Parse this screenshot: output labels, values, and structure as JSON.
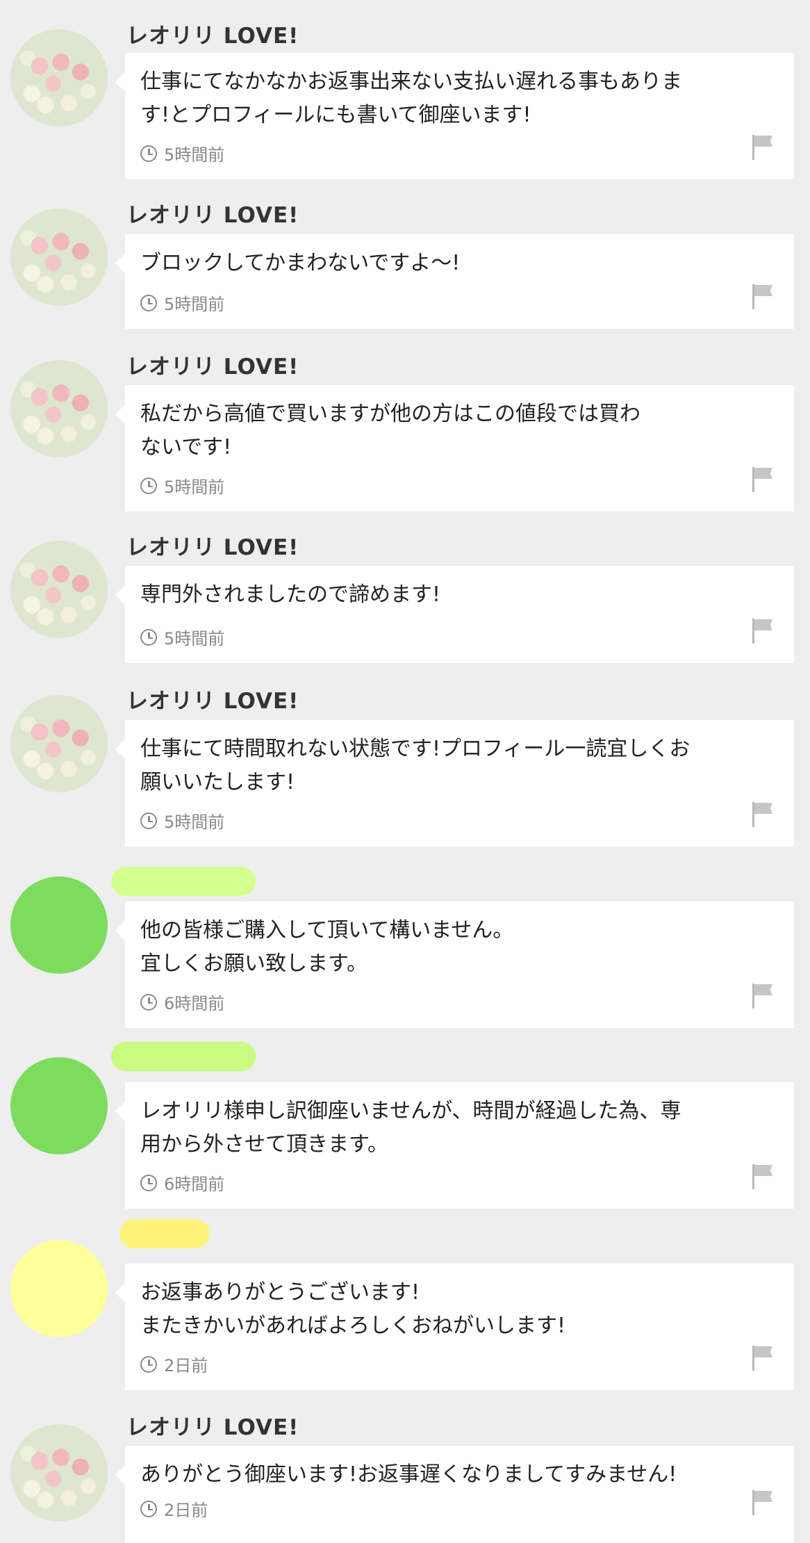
{
  "comments": [
    {
      "username": "レオリリ LOVE!",
      "message": "仕事にてなかなかお返事出来ない支払い遅れる事もありま\nす!とプロフィールにも書いて御座います!",
      "time": "5時間前"
    },
    {
      "username": "レオリリ LOVE!",
      "message": "ブロックしてかまわないですよ〜!",
      "time": "5時間前"
    },
    {
      "username": "レオリリ LOVE!",
      "message": "私だから高値で買いますが他の方はこの値段では買わ\nないです!",
      "time": "5時間前"
    },
    {
      "username": "レオリリ LOVE!",
      "message": "専門外されましたので諦めます!",
      "time": "5時間前"
    },
    {
      "username": "レオリリ LOVE!",
      "message": "仕事にて時間取れない状態です!プロフィール一読宜しくお\n願いいたします!",
      "time": "5時間前"
    },
    {
      "username": "",
      "message": "他の皆様ご購入して頂いて構いません。\n宜しくお願い致します。",
      "time": "6時間前"
    },
    {
      "username": "",
      "message": "レオリリ様申し訳御座いませんが、時間が経過した為、専\n用から外させて頂きます。",
      "time": "6時間前"
    },
    {
      "username": "",
      "message": "お返事ありがとうございます!\nまたきかいがあればよろしくおねがいします!",
      "time": "2日前"
    },
    {
      "username": "レオリリ LOVE!",
      "message": "ありがとう御座います!お返事遅くなりましてすみません!",
      "time": "2日前"
    }
  ],
  "colors": {
    "background": "#eeeeee",
    "seller_avatar": "pearls-photo",
    "green_avatar": "#7ddb5d",
    "yellow_avatar": "#ffff9a"
  }
}
